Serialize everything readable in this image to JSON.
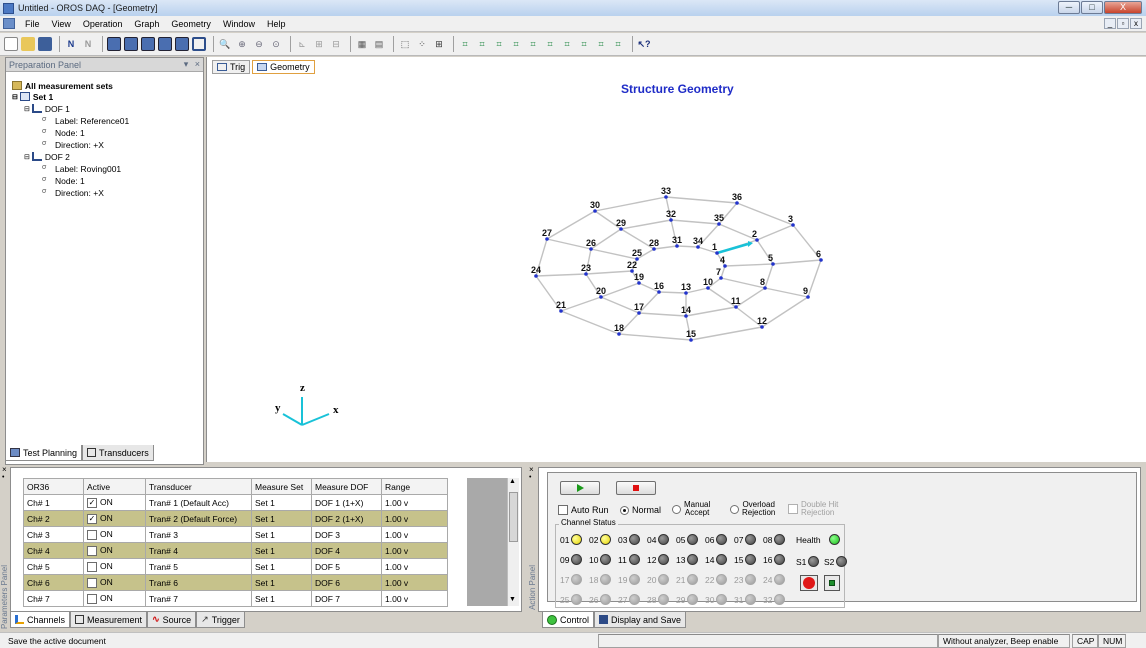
{
  "window": {
    "title": "Untitled - OROS DAQ - [Geometry]",
    "min": "─",
    "max": "□",
    "close": "X"
  },
  "menu": [
    "File",
    "View",
    "Operation",
    "Graph",
    "Geometry",
    "Window",
    "Help"
  ],
  "prep_panel": {
    "title": "Preparation Panel",
    "pin": "▾",
    "close": "×",
    "tree": {
      "root": "All measurement sets",
      "set": "Set 1",
      "dof1": "DOF 1",
      "dof1_label": "Label: Reference01",
      "dof1_node": "Node:  1",
      "dof1_dir": "Direction: +X",
      "dof2": "DOF 2",
      "dof2_label": "Label: Roving001",
      "dof2_node": "Node:  1",
      "dof2_dir": "Direction: +X"
    },
    "tabs": [
      "Test Planning",
      "Transducers"
    ]
  },
  "view": {
    "tabs": [
      "Trig",
      "Geometry"
    ],
    "geometry_title": "Structure Geometry",
    "axes": {
      "x": "x",
      "y": "y",
      "z": "z"
    },
    "node_labels": [
      "33",
      "36",
      "30",
      "32",
      "35",
      "3",
      "29",
      "27",
      "31",
      "34",
      "2",
      "28",
      "26",
      "25",
      "1",
      "4",
      "5",
      "6",
      "24",
      "23",
      "22",
      "7",
      "19",
      "16",
      "13",
      "10",
      "8",
      "20",
      "9",
      "17",
      "11",
      "21",
      "14",
      "12",
      "18",
      "15"
    ]
  },
  "params": {
    "side_label": "Parameters Panel",
    "columns": [
      "OR36",
      "Active",
      "Transducer",
      "Measure Set",
      "Measure DOF",
      "Range"
    ],
    "rows": [
      {
        "ch": "Ch# 1",
        "checked": true,
        "active": "ON",
        "transducer": "Tran# 1 (Default Acc)",
        "set": "Set 1",
        "dof": "DOF 1 (1+X)",
        "range": "1.00 v"
      },
      {
        "ch": "Ch# 2",
        "checked": true,
        "active": "ON",
        "transducer": "Tran# 2 (Default Force)",
        "set": "Set 1",
        "dof": "DOF 2 (1+X)",
        "range": "1.00 v"
      },
      {
        "ch": "Ch# 3",
        "checked": false,
        "active": "ON",
        "transducer": "Tran# 3",
        "set": "Set 1",
        "dof": "DOF 3",
        "range": "1.00 v"
      },
      {
        "ch": "Ch# 4",
        "checked": false,
        "active": "ON",
        "transducer": "Tran# 4",
        "set": "Set 1",
        "dof": "DOF 4",
        "range": "1.00 v"
      },
      {
        "ch": "Ch# 5",
        "checked": false,
        "active": "ON",
        "transducer": "Tran# 5",
        "set": "Set 1",
        "dof": "DOF 5",
        "range": "1.00 v"
      },
      {
        "ch": "Ch# 6",
        "checked": false,
        "active": "ON",
        "transducer": "Tran# 6",
        "set": "Set 1",
        "dof": "DOF 6",
        "range": "1.00 v"
      },
      {
        "ch": "Ch# 7",
        "checked": false,
        "active": "ON",
        "transducer": "Tran# 7",
        "set": "Set 1",
        "dof": "DOF 7",
        "range": "1.00 v"
      }
    ],
    "tabs": [
      "Channels",
      "Measurement",
      "Source",
      "Trigger"
    ]
  },
  "actions": {
    "side_label": "Action Panel",
    "auto_run": "Auto Run",
    "normal": "Normal",
    "manual_accept": [
      "Manual",
      "Accept"
    ],
    "overload_rejection": [
      "Overload",
      "Rejection"
    ],
    "double_hit": [
      "Double Hit",
      "Rejection"
    ],
    "channel_status": "Channel Status",
    "channels_row1": [
      "01",
      "02",
      "03",
      "04",
      "05",
      "06",
      "07",
      "08"
    ],
    "channels_row2": [
      "09",
      "10",
      "11",
      "12",
      "13",
      "14",
      "15",
      "16"
    ],
    "channels_row3": [
      "17",
      "18",
      "19",
      "20",
      "21",
      "22",
      "23",
      "24"
    ],
    "channels_row4": [
      "25",
      "26",
      "27",
      "28",
      "29",
      "30",
      "31",
      "32"
    ],
    "health": "Health",
    "s1": "S1",
    "s2": "S2",
    "tabs": [
      "Control",
      "Display and Save"
    ]
  },
  "status": {
    "message": "Save the active document",
    "analyzer": "Without analyzer, Beep enable",
    "cap": "CAP",
    "num": "NUM"
  },
  "colors": {
    "title_blue": "#1f2cc7",
    "row_highlight": "#c6c28b",
    "mesh": "#c2c2c2",
    "led_yellow": "#e6d400",
    "led_green": "#1bbf1b"
  }
}
